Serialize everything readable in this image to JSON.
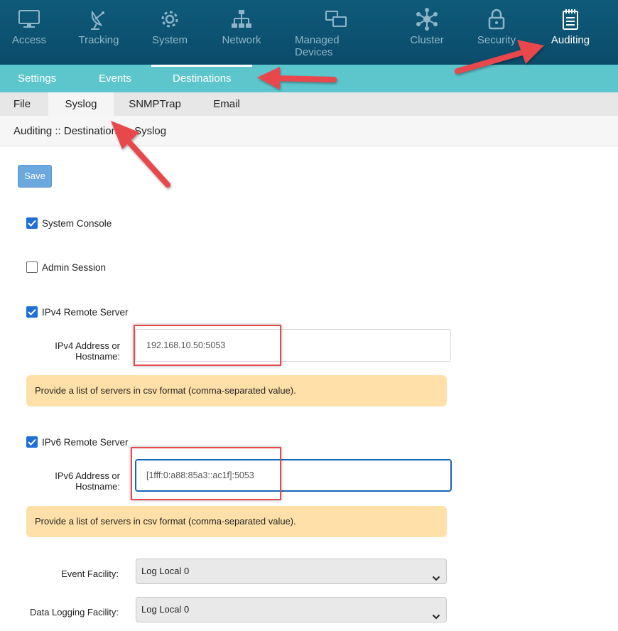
{
  "topnav": {
    "items": [
      {
        "label": "Access",
        "icon": "monitor-icon"
      },
      {
        "label": "Tracking",
        "icon": "satellite-dish-icon"
      },
      {
        "label": "System",
        "icon": "gear-icon"
      },
      {
        "label": "Network",
        "icon": "network-tree-icon"
      },
      {
        "label": "Managed Devices",
        "icon": "devices-icon"
      },
      {
        "label": "Cluster",
        "icon": "cluster-icon"
      },
      {
        "label": "Security",
        "icon": "lock-icon"
      },
      {
        "label": "Auditing",
        "icon": "notepad-icon"
      }
    ],
    "active": "Auditing"
  },
  "subnav": {
    "items": [
      "Settings",
      "Events",
      "Destinations"
    ],
    "active": "Destinations"
  },
  "tabs": {
    "items": [
      "File",
      "Syslog",
      "SNMPTrap",
      "Email"
    ],
    "active": "Syslog"
  },
  "breadcrumb": "Auditing :: Destinations :: Syslog",
  "save_label": "Save",
  "checkboxes": {
    "system_console": {
      "label": "System Console",
      "checked": true
    },
    "admin_session": {
      "label": "Admin Session",
      "checked": false
    },
    "ipv4_remote": {
      "label": "IPv4 Remote Server",
      "checked": true
    },
    "ipv6_remote": {
      "label": "IPv6 Remote Server",
      "checked": true
    }
  },
  "ipv4": {
    "label_line1": "IPv4 Address or",
    "label_line2": "Hostname:",
    "value": "192.168.10.50:5053",
    "hint": "Provide a list of servers in csv format (comma-separated value)."
  },
  "ipv6": {
    "label_line1": "IPv6 Address or",
    "label_line2": "Hostname:",
    "value": "[1fff:0:a88:85a3::ac1f]:5053",
    "hint": "Provide a list of servers in csv format (comma-separated value)."
  },
  "event_facility": {
    "label": "Event Facility:",
    "value": "Log Local 0"
  },
  "data_logging_facility": {
    "label": "Data Logging Facility:",
    "value": "Log Local 0"
  },
  "colors": {
    "topnav_bg": "#0f5a7a",
    "subnav_bg": "#5cc6cc",
    "accent_blue": "#1f6fd6",
    "hint_bg": "#ffe0a8",
    "annotation_red": "#e8474b"
  }
}
